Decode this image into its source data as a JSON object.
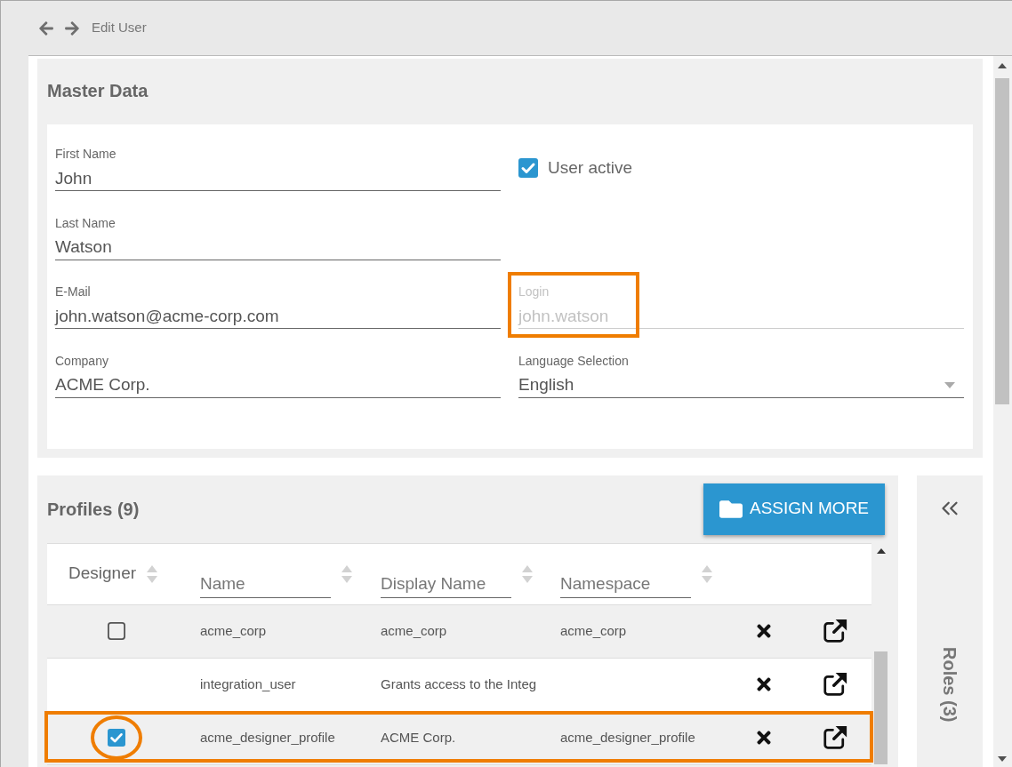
{
  "header": {
    "title": "Edit User"
  },
  "master_data": {
    "title": "Master Data",
    "rows": [
      {
        "left": {
          "kind": "text",
          "label": "First Name",
          "value": "John",
          "disabled": false,
          "highlighted": false
        },
        "right": {
          "kind": "checkbox",
          "label": "User active",
          "checked": true
        }
      },
      {
        "left": {
          "kind": "text",
          "label": "Last Name",
          "value": "Watson",
          "disabled": false,
          "highlighted": false
        }
      },
      {
        "left": {
          "kind": "text",
          "label": "E-Mail",
          "value": "john.watson@acme-corp.com",
          "disabled": false,
          "highlighted": false
        },
        "right": {
          "kind": "text",
          "label": "Login",
          "value": "john.watson",
          "disabled": true,
          "highlighted": true
        }
      },
      {
        "left": {
          "kind": "text",
          "label": "Company",
          "value": "ACME Corp.",
          "disabled": false,
          "highlighted": false
        },
        "right": {
          "kind": "select",
          "label": "Language Selection",
          "value": "English",
          "disabled": false,
          "highlighted": false
        }
      }
    ]
  },
  "profiles": {
    "title": "Profiles (9)",
    "assign_button": "ASSIGN MORE",
    "table": {
      "columns": [
        {
          "kind": "label",
          "label": "Designer"
        },
        {
          "kind": "filter",
          "placeholder": "Name"
        },
        {
          "kind": "filter",
          "placeholder": "Display Name"
        },
        {
          "kind": "filter",
          "placeholder": "Namespace"
        }
      ],
      "rows": [
        {
          "designer": {
            "checked": false,
            "circled": false
          },
          "name": "acme_corp",
          "display_name": "acme_corp",
          "namespace": "acme_corp",
          "highlighted": false
        },
        {
          "name": "integration_user",
          "display_name": "Grants access to the Integ",
          "highlighted": false
        },
        {
          "designer": {
            "checked": true,
            "circled": true
          },
          "name": "acme_designer_profile",
          "display_name": "ACME Corp.",
          "namespace": "acme_designer_profile",
          "highlighted": true
        }
      ]
    }
  },
  "roles_panel": {
    "title": "Roles (3)",
    "expanded": false
  }
}
